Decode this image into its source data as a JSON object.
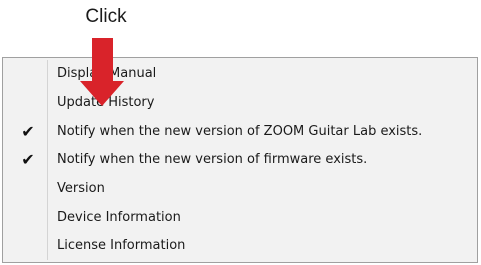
{
  "annotation": {
    "label": "Click",
    "arrow_color": "#d9232a"
  },
  "menu": {
    "items": [
      {
        "label": "Display Manual",
        "checked": false
      },
      {
        "label": "Update History",
        "checked": false
      },
      {
        "label": "Notify when the new version of ZOOM Guitar Lab exists.",
        "checked": true
      },
      {
        "label": "Notify when the new version of firmware exists.",
        "checked": true
      },
      {
        "label": "Version",
        "checked": false
      },
      {
        "label": "Device Information",
        "checked": false
      },
      {
        "label": "License Information",
        "checked": false
      }
    ],
    "check_glyph": "✔"
  }
}
